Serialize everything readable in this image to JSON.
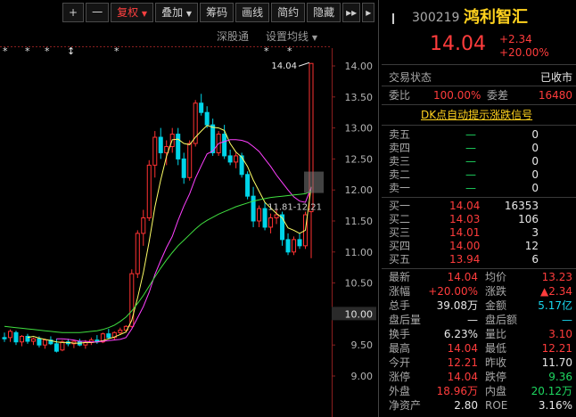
{
  "toolbar": {
    "plus": "+",
    "minus": "一",
    "fuquan": "复权",
    "diejia": "叠加",
    "chouma": "筹码",
    "huaxian": "画线",
    "jianyue": "简约",
    "yincang": "隐藏",
    "forward": "▸▸",
    "collapse": "▸"
  },
  "subtoolbar": {
    "shengutong": "深股通",
    "shezhi": "设置均线"
  },
  "markers": [
    "*",
    "*",
    "*",
    "↕",
    "*",
    "*",
    "*"
  ],
  "chart_data": {
    "type": "candlestick",
    "ylim": [
      8.8,
      14.2
    ],
    "y_ticks": [
      "14.00",
      "13.50",
      "13.00",
      "12.50",
      "12.00",
      "11.50",
      "11.00",
      "10.50",
      "10.00",
      "9.50",
      "9.00"
    ],
    "crosshair_price": "10.00",
    "high_label": "14.04",
    "low_label": "11.81-12.21",
    "up_color": "#ff3232",
    "down_color": "#00d4e8",
    "candles": [
      [
        9.62,
        9.7,
        9.55,
        9.6
      ],
      [
        9.62,
        9.75,
        9.55,
        9.72
      ],
      [
        9.7,
        9.73,
        9.5,
        9.55
      ],
      [
        9.55,
        9.66,
        9.48,
        9.64
      ],
      [
        9.64,
        9.68,
        9.52,
        9.56
      ],
      [
        9.56,
        9.62,
        9.5,
        9.6
      ],
      [
        9.6,
        9.64,
        9.46,
        9.5
      ],
      [
        9.5,
        9.6,
        9.44,
        9.58
      ],
      [
        9.58,
        9.64,
        9.5,
        9.52
      ],
      [
        9.52,
        9.6,
        9.38,
        9.4
      ],
      [
        9.42,
        9.58,
        9.4,
        9.55
      ],
      [
        9.55,
        9.6,
        9.48,
        9.52
      ],
      [
        9.52,
        9.58,
        9.45,
        9.56
      ],
      [
        9.56,
        9.6,
        9.48,
        9.5
      ],
      [
        9.5,
        9.58,
        9.44,
        9.54
      ],
      [
        9.54,
        9.62,
        9.5,
        9.58
      ],
      [
        9.58,
        9.66,
        9.52,
        9.55
      ],
      [
        9.55,
        9.7,
        9.53,
        9.68
      ],
      [
        9.68,
        9.76,
        9.6,
        9.62
      ],
      [
        9.62,
        9.72,
        9.58,
        9.7
      ],
      [
        9.7,
        9.78,
        9.66,
        9.74
      ],
      [
        9.74,
        9.82,
        9.7,
        9.8
      ],
      [
        9.8,
        10.72,
        9.78,
        10.65
      ],
      [
        10.65,
        11.35,
        10.58,
        11.3
      ],
      [
        11.3,
        11.68,
        11.1,
        11.55
      ],
      [
        11.55,
        12.48,
        11.5,
        12.4
      ],
      [
        12.4,
        12.95,
        12.2,
        12.85
      ],
      [
        12.85,
        13.0,
        12.5,
        12.6
      ],
      [
        12.6,
        12.8,
        12.4,
        12.7
      ],
      [
        12.7,
        13.0,
        12.6,
        12.9
      ],
      [
        12.9,
        13.0,
        12.4,
        12.5
      ],
      [
        12.5,
        12.6,
        12.1,
        12.2
      ],
      [
        12.2,
        12.8,
        12.15,
        12.75
      ],
      [
        12.75,
        13.45,
        12.7,
        13.4
      ],
      [
        13.4,
        13.55,
        13.2,
        13.25
      ],
      [
        13.25,
        13.35,
        13.0,
        13.05
      ],
      [
        13.05,
        13.15,
        12.55,
        12.6
      ],
      [
        12.6,
        12.95,
        12.55,
        12.9
      ],
      [
        12.9,
        13.05,
        12.5,
        12.55
      ],
      [
        12.55,
        12.65,
        12.4,
        12.45
      ],
      [
        12.45,
        12.6,
        12.35,
        12.55
      ],
      [
        12.55,
        12.6,
        12.2,
        12.25
      ],
      [
        12.25,
        12.3,
        11.85,
        11.9
      ],
      [
        11.9,
        12.05,
        11.4,
        11.5
      ],
      [
        11.5,
        11.75,
        11.4,
        11.7
      ],
      [
        11.7,
        11.8,
        11.35,
        11.4
      ],
      [
        11.4,
        11.62,
        11.3,
        11.55
      ],
      [
        11.55,
        11.7,
        11.45,
        11.6
      ],
      [
        11.6,
        11.65,
        11.1,
        11.2
      ],
      [
        11.2,
        11.3,
        10.95,
        11.0
      ],
      [
        11.0,
        11.25,
        10.95,
        11.2
      ],
      [
        11.2,
        11.3,
        11.05,
        11.1
      ],
      [
        11.1,
        11.65,
        11.05,
        11.6
      ],
      [
        11.65,
        14.04,
        10.9,
        14.04
      ]
    ],
    "ma_lines": [
      {
        "color": "#ffff66",
        "values": [
          null,
          null,
          null,
          null,
          9.62,
          9.64,
          9.61,
          9.59,
          9.57,
          9.55,
          9.54,
          9.54,
          9.53,
          9.53,
          9.54,
          9.54,
          9.55,
          9.57,
          9.6,
          9.63,
          9.67,
          9.71,
          9.9,
          10.26,
          10.67,
          11.17,
          11.73,
          12.16,
          12.54,
          12.81,
          12.82,
          12.75,
          12.73,
          12.85,
          12.95,
          13.04,
          13.01,
          13.0,
          12.96,
          12.75,
          12.61,
          12.53,
          12.38,
          12.16,
          11.98,
          11.8,
          11.71,
          11.62,
          11.55,
          11.39,
          11.35,
          11.3,
          11.35,
          12.05
        ]
      },
      {
        "color": "#ff40ff",
        "values": [
          null,
          null,
          null,
          null,
          null,
          null,
          null,
          null,
          null,
          9.6,
          9.6,
          9.59,
          9.58,
          9.56,
          9.56,
          9.55,
          9.55,
          9.56,
          9.57,
          9.58,
          9.59,
          9.62,
          9.76,
          9.94,
          10.12,
          10.35,
          10.64,
          10.86,
          11.07,
          11.25,
          11.51,
          11.74,
          11.94,
          12.19,
          12.39,
          12.58,
          12.63,
          12.75,
          12.78,
          12.81,
          12.81,
          12.8,
          12.77,
          12.7,
          12.62,
          12.5,
          12.38,
          12.24,
          12.12,
          12.0,
          11.89,
          11.82,
          11.8,
          12.04
        ]
      },
      {
        "color": "#40e040",
        "values": [
          9.8,
          9.79,
          9.78,
          9.77,
          9.76,
          9.75,
          9.74,
          9.73,
          9.72,
          9.71,
          9.7,
          9.7,
          9.7,
          9.7,
          9.71,
          9.72,
          9.73,
          9.75,
          9.78,
          9.82,
          9.88,
          9.95,
          10.05,
          10.17,
          10.3,
          10.45,
          10.6,
          10.74,
          10.87,
          10.99,
          11.1,
          11.19,
          11.28,
          11.37,
          11.45,
          11.51,
          11.56,
          11.61,
          11.65,
          11.69,
          11.73,
          11.76,
          11.79,
          11.82,
          11.84,
          11.86,
          11.88,
          11.89,
          11.9,
          11.91,
          11.92,
          11.93,
          11.94,
          11.98
        ]
      }
    ]
  },
  "quote": {
    "code": "300219",
    "name": "鸿利智汇",
    "price": "14.04",
    "change": "+2.34",
    "change_pct": "+20.00%",
    "status_label": "交易状态",
    "status_value": "已收市",
    "weibi_label": "委比",
    "weibi_value": "100.00%",
    "weicha_label": "委差",
    "weicha_value": "16480",
    "dk_link": "DK点自动提示涨跌信号",
    "asks": [
      {
        "label": "卖五",
        "price": "—",
        "vol": "0"
      },
      {
        "label": "卖四",
        "price": "—",
        "vol": "0"
      },
      {
        "label": "卖三",
        "price": "—",
        "vol": "0"
      },
      {
        "label": "卖二",
        "price": "—",
        "vol": "0"
      },
      {
        "label": "卖一",
        "price": "—",
        "vol": "0"
      }
    ],
    "bids": [
      {
        "label": "买一",
        "price": "14.04",
        "vol": "16353"
      },
      {
        "label": "买二",
        "price": "14.03",
        "vol": "106"
      },
      {
        "label": "买三",
        "price": "14.01",
        "vol": "3"
      },
      {
        "label": "买四",
        "price": "14.00",
        "vol": "12"
      },
      {
        "label": "买五",
        "price": "13.94",
        "vol": "6"
      }
    ],
    "stats": [
      {
        "l1": "最新",
        "v1": "14.04",
        "c1": "red",
        "l2": "均价",
        "v2": "13.23",
        "c2": "red"
      },
      {
        "l1": "涨幅",
        "v1": "+20.00%",
        "c1": "red",
        "l2": "涨跌",
        "v2": "▲2.34",
        "c2": "red"
      },
      {
        "l1": "总手",
        "v1": "39.08万",
        "c1": "white",
        "l2": "金额",
        "v2": "5.17亿",
        "c2": "cyan"
      },
      {
        "l1": "盘后量",
        "v1": "—",
        "c1": "white",
        "l2": "盘后额",
        "v2": "—",
        "c2": "cyan"
      },
      {
        "l1": "换手",
        "v1": "6.23%",
        "c1": "white",
        "l2": "量比",
        "v2": "3.10",
        "c2": "red"
      },
      {
        "l1": "最高",
        "v1": "14.04",
        "c1": "red",
        "l2": "最低",
        "v2": "12.21",
        "c2": "red"
      },
      {
        "l1": "今开",
        "v1": "12.21",
        "c1": "red",
        "l2": "昨收",
        "v2": "11.70",
        "c2": "white"
      },
      {
        "l1": "涨停",
        "v1": "14.04",
        "c1": "red",
        "l2": "跌停",
        "v2": "9.36",
        "c2": "green"
      },
      {
        "l1": "外盘",
        "v1": "18.96万",
        "c1": "red",
        "l2": "内盘",
        "v2": "20.12万",
        "c2": "green"
      },
      {
        "l1": "净资产",
        "v1": "2.80",
        "c1": "white",
        "l2": "ROE",
        "v2": "3.16%",
        "c2": "white"
      }
    ]
  }
}
